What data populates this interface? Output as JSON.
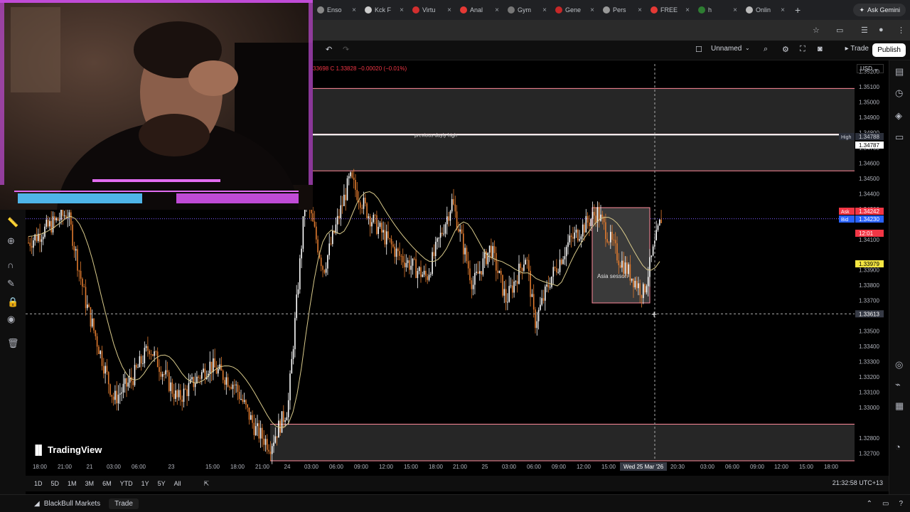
{
  "browser": {
    "tabs": [
      {
        "label": "Enso",
        "color": "#888"
      },
      {
        "label": "Kck F",
        "color": "#ccc"
      },
      {
        "label": "Virtu",
        "color": "#d32f2f"
      },
      {
        "label": "Anal",
        "color": "#e53935"
      },
      {
        "label": "Gym",
        "color": "#777"
      },
      {
        "label": "Gene",
        "color": "#c62828"
      },
      {
        "label": "Pers",
        "color": "#999"
      },
      {
        "label": "FREE",
        "color": "#e53935"
      },
      {
        "label": "h",
        "color": "#2e7d32"
      },
      {
        "label": "Onlin",
        "color": "#bbb"
      }
    ],
    "ask_gemini": "Ask Gemini"
  },
  "toolbar": {
    "layout_name": "Unnamed",
    "trade_label": "Trade",
    "publish_label": "Publish"
  },
  "legend": {
    "ohlc_text": "33698  C 1.33828  −0.00020 (−0.01%)",
    "currency": "USD"
  },
  "chart_data": {
    "type": "candlestick",
    "price_axis": [
      "1.35200",
      "1.35100",
      "1.35000",
      "1.34900",
      "1.34800",
      "1.34700",
      "1.34600",
      "1.34500",
      "1.34400",
      "1.34300",
      "1.34100",
      "1.33900",
      "1.33800",
      "1.33700",
      "1.33500",
      "1.33400",
      "1.33300",
      "1.33200",
      "1.33100",
      "1.33000",
      "1.32800",
      "1.32700"
    ],
    "time_axis": [
      "18:00",
      "21:00",
      "21",
      "03:00",
      "06:00",
      "23",
      "15:00",
      "18:00",
      "21:00",
      "24",
      "03:00",
      "06:00",
      "09:00",
      "12:00",
      "15:00",
      "18:00",
      "21:00",
      "25",
      "03:00",
      "06:00",
      "09:00",
      "12:00",
      "15:00",
      "20:30",
      "03:00",
      "06:00",
      "09:00",
      "12:00",
      "15:00",
      "18:00"
    ],
    "crosshair_time": "Wed 25 Mar '26",
    "crosshair_price": "1.33613",
    "price_labels": {
      "high_label": "High",
      "high": "1.34788",
      "previous_high": "1.34787",
      "ask_label": "Ask",
      "ask": "1.34242",
      "bid_label": "Bid",
      "bid": "1.34230",
      "countdown": "12:01",
      "ma": "1.33979"
    },
    "annotations": {
      "previous_daily_high": "previous dayly high",
      "asia_session": "Asia sesson"
    },
    "zones": [
      {
        "top": 1.3509,
        "bottom": 1.3479
      },
      {
        "top": 1.3479,
        "bottom": 1.3455
      },
      {
        "top": 1.3289,
        "bottom": 1.3265
      }
    ],
    "ylim": [
      1.3265,
      1.3525
    ]
  },
  "periods": [
    "1D",
    "5D",
    "1M",
    "3M",
    "6M",
    "YTD",
    "1Y",
    "5Y",
    "All"
  ],
  "status": {
    "clock": "21:32:58 UTC+13",
    "broker": "BlackBull Markets",
    "broker_trade": "Trade",
    "branding": "TradingView"
  },
  "colors": {
    "up": "#ffffff",
    "down": "#e07a2e",
    "zone_line": "#ff8a9a",
    "ma": "#d8c98a"
  }
}
